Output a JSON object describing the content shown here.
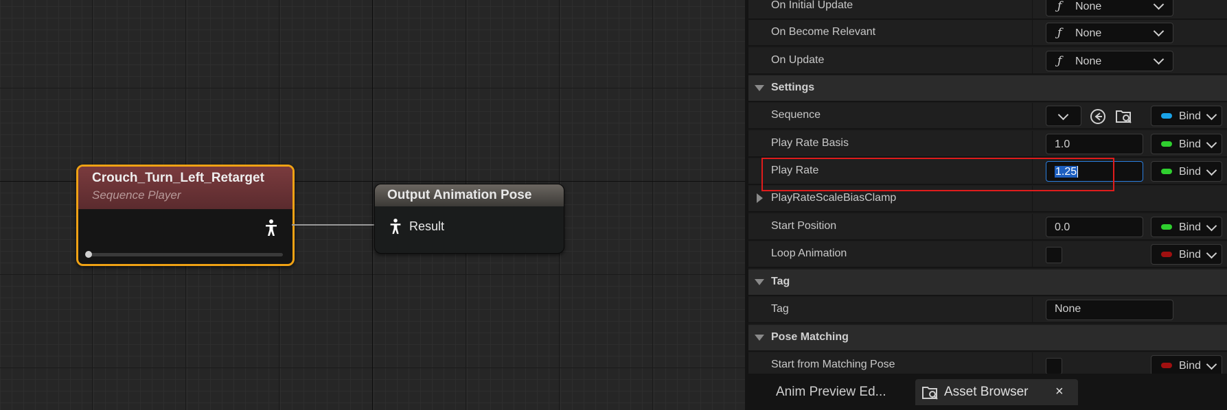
{
  "graph": {
    "node_sequence": {
      "title": "Crouch_Turn_Left_Retarget",
      "subtitle": "Sequence Player"
    },
    "node_output": {
      "title": "Output Animation Pose",
      "pin_label": "Result"
    }
  },
  "details": {
    "rows": {
      "on_initial_update": {
        "label": "On Initial Update",
        "value": "None"
      },
      "on_become_relevant": {
        "label": "On Become Relevant",
        "value": "None"
      },
      "on_update": {
        "label": "On Update",
        "value": "None"
      },
      "settings": {
        "label": "Settings"
      },
      "sequence": {
        "label": "Sequence"
      },
      "play_rate_basis": {
        "label": "Play Rate Basis",
        "value": "1.0"
      },
      "play_rate": {
        "label": "Play Rate",
        "value": "1.25"
      },
      "play_rate_scale_bias_clamp": {
        "label": "PlayRateScaleBiasClamp"
      },
      "start_position": {
        "label": "Start Position",
        "value": "0.0"
      },
      "loop_animation": {
        "label": "Loop Animation"
      },
      "tag_section": {
        "label": "Tag"
      },
      "tag": {
        "label": "Tag",
        "value": "None"
      },
      "pose_matching": {
        "label": "Pose Matching"
      },
      "start_from_matching_pose": {
        "label": "Start from Matching Pose"
      }
    },
    "function_glyph": "ƒ",
    "bind_label": "Bind",
    "bind_colors": {
      "blue": "#1aa3e8",
      "green": "#2fcf2f",
      "red": "#a01010"
    }
  },
  "tabs": {
    "anim_preview": "Anim Preview Ed...",
    "asset_browser": "Asset Browser",
    "close": "×"
  }
}
